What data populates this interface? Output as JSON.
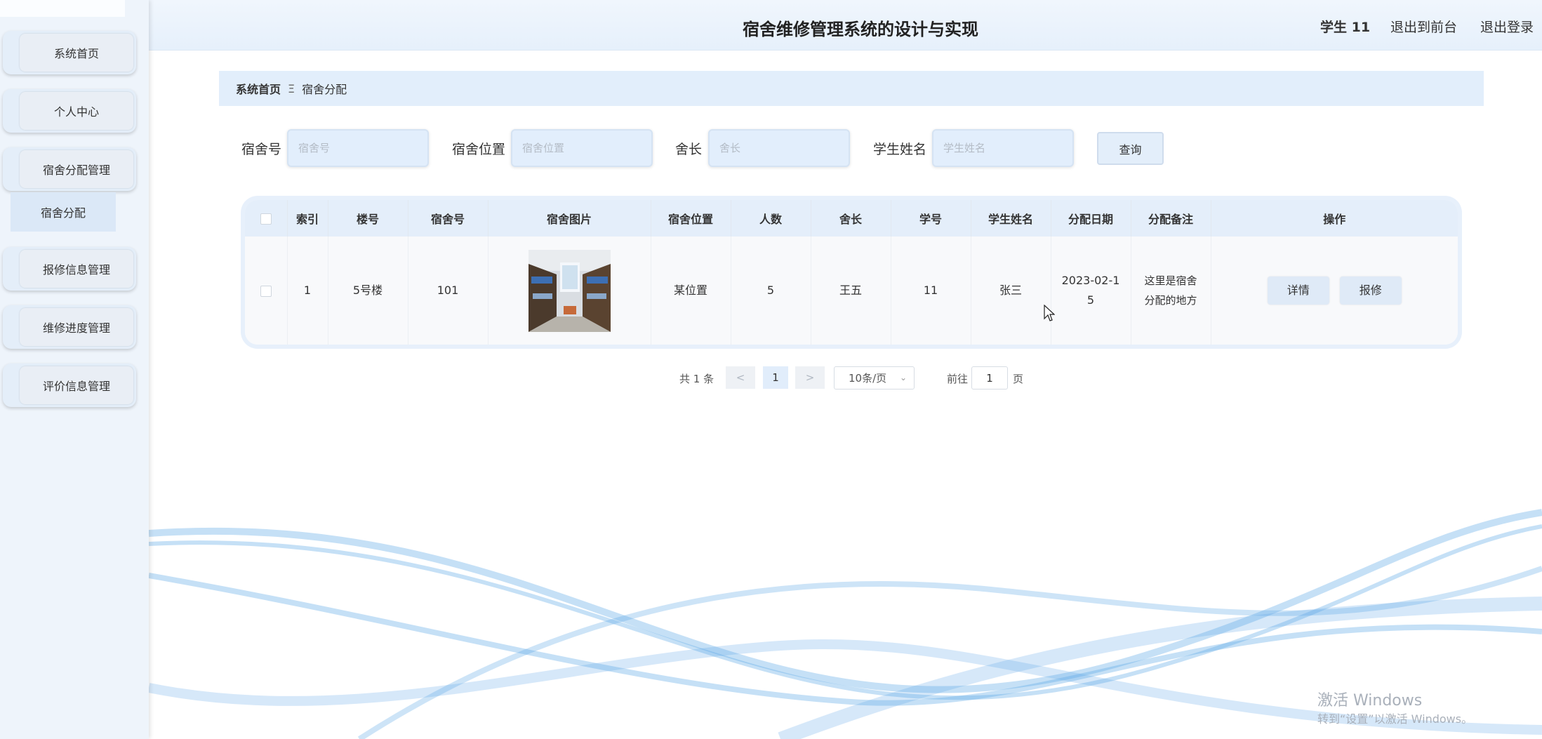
{
  "app": {
    "title": "宿舍维修管理系统的设计与实现",
    "user": "学生 11",
    "nav_front": "退出到前台",
    "nav_logout": "退出登录"
  },
  "sidebar": {
    "items": [
      {
        "label": "系统首页"
      },
      {
        "label": "个人中心"
      },
      {
        "label": "宿舍分配管理"
      },
      {
        "label": "报修信息管理"
      },
      {
        "label": "维修进度管理"
      },
      {
        "label": "评价信息管理"
      }
    ],
    "submenu": {
      "label": "宿舍分配"
    }
  },
  "breadcrumb": {
    "home": "系统首页",
    "separator": "Ξ",
    "current": "宿舍分配"
  },
  "search": {
    "dorm_no_label": "宿舍号",
    "dorm_no_placeholder": "宿舍号",
    "location_label": "宿舍位置",
    "location_placeholder": "宿舍位置",
    "leader_label": "舍长",
    "leader_placeholder": "舍长",
    "student_label": "学生姓名",
    "student_placeholder": "学生姓名",
    "query_label": "查询"
  },
  "table": {
    "headers": [
      "索引",
      "楼号",
      "宿舍号",
      "宿舍图片",
      "宿舍位置",
      "人数",
      "舍长",
      "学号",
      "学生姓名",
      "分配日期",
      "分配备注",
      "操作"
    ],
    "rows": [
      {
        "index": "1",
        "building": "5号楼",
        "dorm_no": "101",
        "photo_icon": "dorm-room-photo",
        "location": "某位置",
        "count": "5",
        "leader": "王五",
        "student_id": "11",
        "student_name": "张三",
        "date_line1": "2023-02-1",
        "date_line2": "5",
        "note_line1": "这里是宿舍",
        "note_line2": "分配的地方",
        "detail_label": "详情",
        "repair_label": "报修"
      }
    ]
  },
  "pagination": {
    "total": "共 1 条",
    "prev": "<",
    "current": "1",
    "next": ">",
    "page_size": "10条/页",
    "goto_label": "前往",
    "goto_value": "1",
    "goto_unit": "页"
  },
  "watermark": {
    "line1": "激活 Windows",
    "line2": "转到“设置”以激活 Windows。"
  },
  "colors": {
    "accent": "#e2eefb",
    "sidebar_bg": "#eef4fb",
    "wave": "#4a9be0"
  }
}
